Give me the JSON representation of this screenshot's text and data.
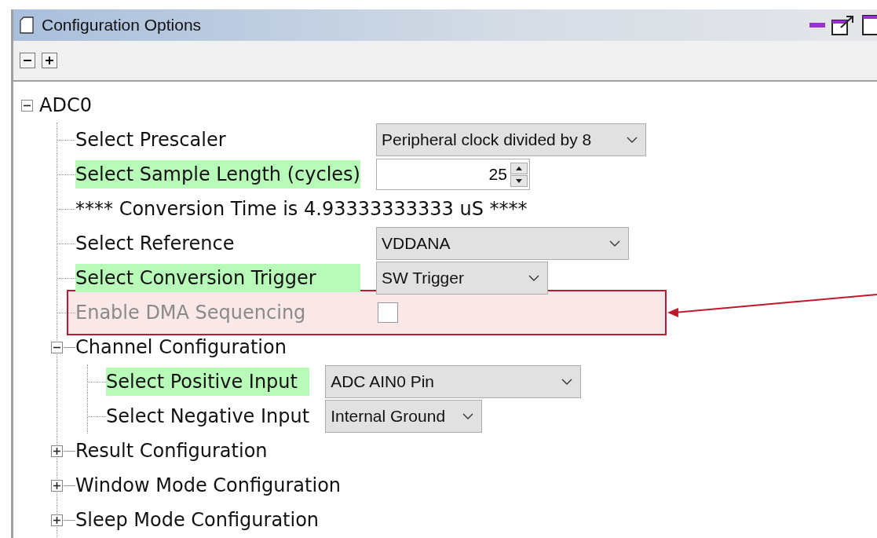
{
  "panel": {
    "title": "Configuration Options"
  },
  "toolbar": [
    {
      "kind": "collapse"
    },
    {
      "kind": "expand"
    }
  ],
  "tree": [
    {
      "kind": "group",
      "label": "ADC0",
      "expanded": true,
      "children": [
        {
          "kind": "combo",
          "label": "Select Prescaler",
          "highlighted": false,
          "disabled": false,
          "value": "Peripheral clock divided by 8"
        },
        {
          "kind": "spin",
          "label": "Select Sample Length (cycles)",
          "highlighted": true,
          "disabled": false,
          "value": "25"
        },
        {
          "kind": "text",
          "label": "**** Conversion Time is 4.93333333333 uS ****",
          "highlighted": false,
          "disabled": false
        },
        {
          "kind": "combo",
          "label": "Select Reference",
          "highlighted": false,
          "disabled": false,
          "value": "VDDANA"
        },
        {
          "kind": "combo",
          "label": "Select Conversion Trigger",
          "highlighted": true,
          "disabled": false,
          "value": "SW Trigger"
        },
        {
          "kind": "checkbox",
          "label": "Enable DMA Sequencing",
          "highlighted": false,
          "disabled": true,
          "checked": false,
          "callout": true
        },
        {
          "kind": "group",
          "label": "Channel Configuration",
          "expanded": true,
          "children": [
            {
              "kind": "combo",
              "label": "Select Positive Input",
              "highlighted": true,
              "disabled": false,
              "value": "ADC AIN0 Pin"
            },
            {
              "kind": "combo",
              "label": "Select Negative Input",
              "highlighted": false,
              "disabled": false,
              "value": "Internal Ground"
            }
          ]
        },
        {
          "kind": "group",
          "label": "Result Configuration",
          "expanded": false
        },
        {
          "kind": "group",
          "label": "Window Mode Configuration",
          "expanded": false
        },
        {
          "kind": "group",
          "label": "Sleep Mode Configuration",
          "expanded": false
        }
      ]
    }
  ]
}
